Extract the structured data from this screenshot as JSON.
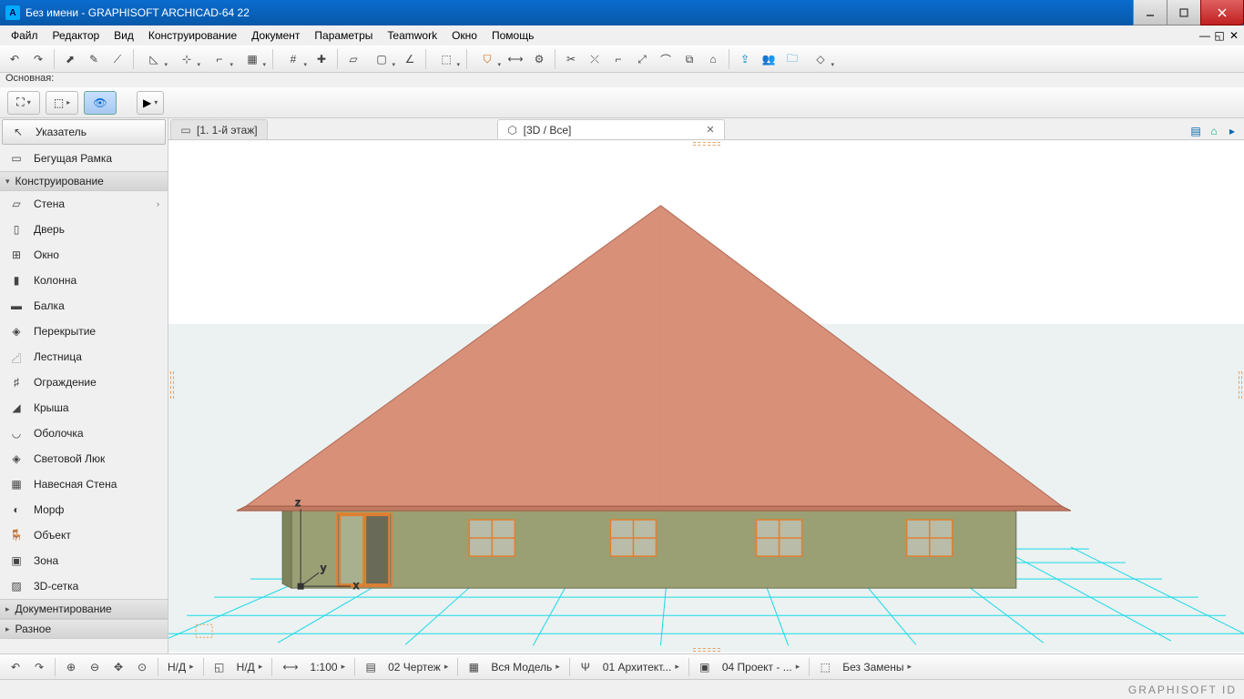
{
  "window": {
    "title": "Без имени - GRAPHISOFT ARCHICAD-64 22"
  },
  "menu": {
    "items": [
      "Файл",
      "Редактор",
      "Вид",
      "Конструирование",
      "Документ",
      "Параметры",
      "Teamwork",
      "Окно",
      "Помощь"
    ]
  },
  "toolbar_label": "Основная:",
  "tabs": {
    "floor": "[1. 1-й этаж]",
    "view3d": "[3D / Все]"
  },
  "sidebar": {
    "pointer": "Указатель",
    "marquee": "Бегущая Рамка",
    "section_design": "Конструирование",
    "tools": [
      "Стена",
      "Дверь",
      "Окно",
      "Колонна",
      "Балка",
      "Перекрытие",
      "Лестница",
      "Ограждение",
      "Крыша",
      "Оболочка",
      "Световой Люк",
      "Навесная Стена",
      "Морф",
      "Объект",
      "Зона",
      "3D-сетка"
    ],
    "section_doc": "Документирование",
    "section_misc": "Разное"
  },
  "bottom": {
    "nd1": "Н/Д",
    "nd2": "Н/Д",
    "scale": "1:100",
    "drawing": "02 Чертеж",
    "model": "Вся Модель",
    "arch": "01 Архитект...",
    "project": "04 Проект - ...",
    "replace": "Без Замены"
  },
  "footer": {
    "brand": "GRAPHISOFT ID"
  }
}
